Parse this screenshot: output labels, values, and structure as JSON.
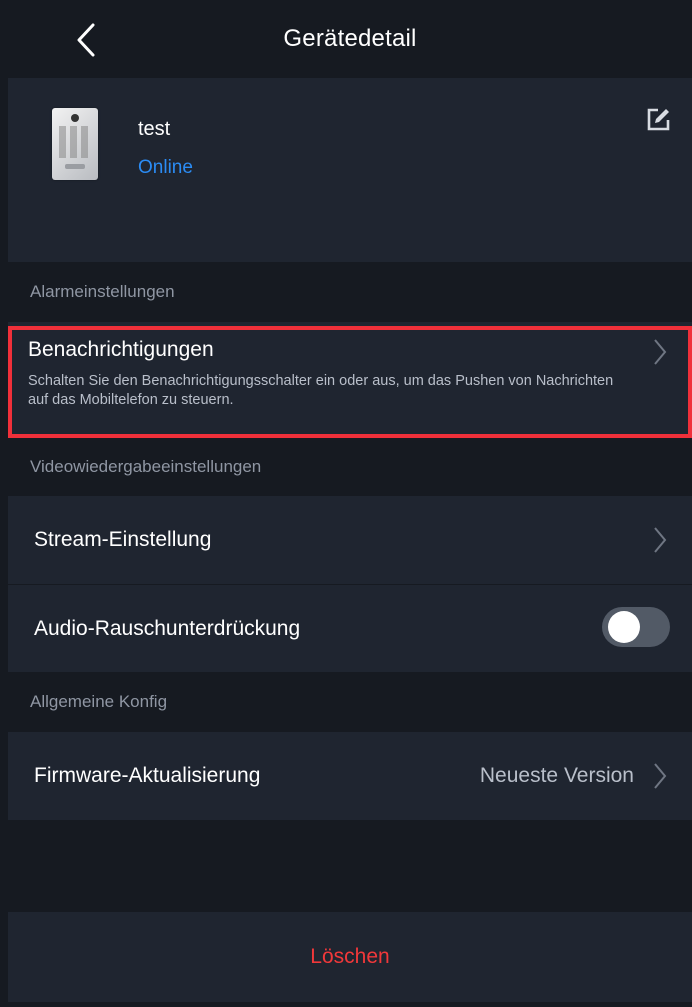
{
  "header": {
    "title": "Gerätedetail",
    "back_icon": "chevron-left-icon"
  },
  "device": {
    "name": "test",
    "status": "Online",
    "status_color": "#2b8cf4",
    "edit_icon": "edit-icon"
  },
  "sections": {
    "alarm": {
      "title": "Alarmeinstellungen",
      "notifications": {
        "label": "Benachrichtigungen",
        "description": "Schalten Sie den Benachrichtigungsschalter ein oder aus, um das Pushen von Nachrichten auf das Mobiltelefon zu steuern."
      }
    },
    "video": {
      "title": "Videowiedergabeeinstellungen",
      "stream": {
        "label": "Stream-Einstellung"
      },
      "noise": {
        "label": "Audio-Rauschunterdrückung",
        "enabled": false
      }
    },
    "general": {
      "title": "Allgemeine Konfig",
      "firmware": {
        "label": "Firmware-Aktualisierung",
        "value": "Neueste Version"
      }
    }
  },
  "delete": {
    "label": "Löschen",
    "color": "#f0383a"
  },
  "colors": {
    "background": "#161a21",
    "card": "#1f2530",
    "highlight": "#f0303a"
  }
}
